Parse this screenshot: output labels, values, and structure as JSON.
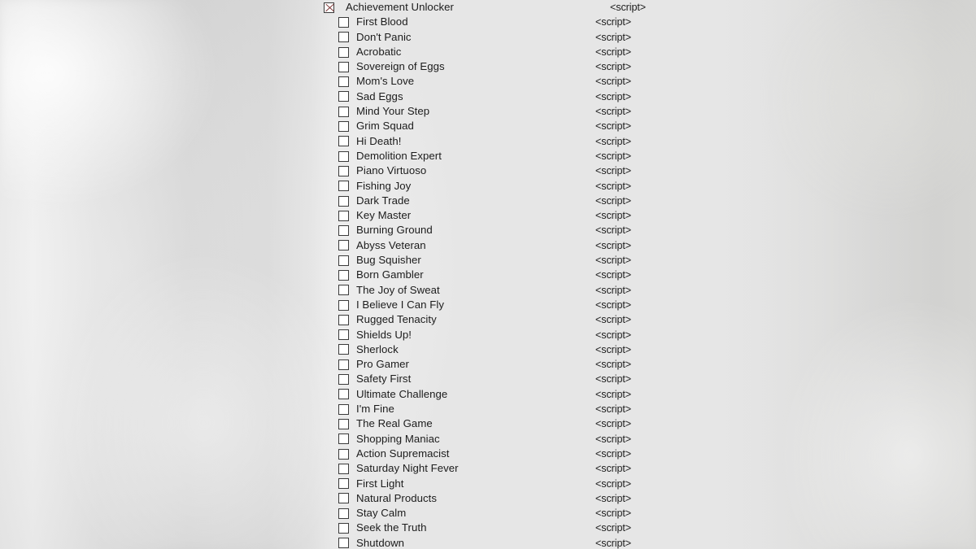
{
  "window": {
    "title": "Achievement Unlocker",
    "background_left_color": "#e6e6e6",
    "background_right_color": "#ececea",
    "panel_color": "#ffffff"
  },
  "tree": {
    "root": {
      "label": "Achievement Unlocker",
      "checkbox_state": "checked",
      "checkbox_mark": "x-mark",
      "checkbox_mark_color": "#7a3030",
      "value": "<script>"
    },
    "value_column_label": "<script>",
    "items": [
      {
        "label": "First Blood",
        "checkbox_state": "unchecked",
        "value": "<script>"
      },
      {
        "label": "Don't Panic",
        "checkbox_state": "unchecked",
        "value": "<script>"
      },
      {
        "label": "Acrobatic",
        "checkbox_state": "unchecked",
        "value": "<script>"
      },
      {
        "label": "Sovereign of Eggs",
        "checkbox_state": "unchecked",
        "value": "<script>"
      },
      {
        "label": "Mom's Love",
        "checkbox_state": "unchecked",
        "value": "<script>"
      },
      {
        "label": "Sad Eggs",
        "checkbox_state": "unchecked",
        "value": "<script>"
      },
      {
        "label": "Mind Your Step",
        "checkbox_state": "unchecked",
        "value": "<script>"
      },
      {
        "label": "Grim Squad",
        "checkbox_state": "unchecked",
        "value": "<script>"
      },
      {
        "label": "Hi Death!",
        "checkbox_state": "unchecked",
        "value": "<script>"
      },
      {
        "label": "Demolition Expert",
        "checkbox_state": "unchecked",
        "value": "<script>"
      },
      {
        "label": "Piano Virtuoso",
        "checkbox_state": "unchecked",
        "value": "<script>"
      },
      {
        "label": "Fishing Joy",
        "checkbox_state": "unchecked",
        "value": "<script>"
      },
      {
        "label": "Dark Trade",
        "checkbox_state": "unchecked",
        "value": "<script>"
      },
      {
        "label": "Key Master",
        "checkbox_state": "unchecked",
        "value": "<script>"
      },
      {
        "label": "Burning Ground",
        "checkbox_state": "unchecked",
        "value": "<script>"
      },
      {
        "label": "Abyss Veteran",
        "checkbox_state": "unchecked",
        "value": "<script>"
      },
      {
        "label": "Bug Squisher",
        "checkbox_state": "unchecked",
        "value": "<script>"
      },
      {
        "label": "Born Gambler",
        "checkbox_state": "unchecked",
        "value": "<script>"
      },
      {
        "label": "The Joy of Sweat",
        "checkbox_state": "unchecked",
        "value": "<script>"
      },
      {
        "label": "I Believe I Can Fly",
        "checkbox_state": "unchecked",
        "value": "<script>"
      },
      {
        "label": "Rugged Tenacity",
        "checkbox_state": "unchecked",
        "value": "<script>"
      },
      {
        "label": "Shields Up!",
        "checkbox_state": "unchecked",
        "value": "<script>"
      },
      {
        "label": "Sherlock",
        "checkbox_state": "unchecked",
        "value": "<script>"
      },
      {
        "label": "Pro Gamer",
        "checkbox_state": "unchecked",
        "value": "<script>"
      },
      {
        "label": "Safety First",
        "checkbox_state": "unchecked",
        "value": "<script>"
      },
      {
        "label": "Ultimate Challenge",
        "checkbox_state": "unchecked",
        "value": "<script>"
      },
      {
        "label": "I'm Fine",
        "checkbox_state": "unchecked",
        "value": "<script>"
      },
      {
        "label": "The Real Game",
        "checkbox_state": "unchecked",
        "value": "<script>"
      },
      {
        "label": "Shopping Maniac",
        "checkbox_state": "unchecked",
        "value": "<script>"
      },
      {
        "label": "Action Supremacist",
        "checkbox_state": "unchecked",
        "value": "<script>"
      },
      {
        "label": "Saturday Night Fever",
        "checkbox_state": "unchecked",
        "value": "<script>"
      },
      {
        "label": "First Light",
        "checkbox_state": "unchecked",
        "value": "<script>"
      },
      {
        "label": "Natural Products",
        "checkbox_state": "unchecked",
        "value": "<script>"
      },
      {
        "label": "Stay Calm",
        "checkbox_state": "unchecked",
        "value": "<script>"
      },
      {
        "label": "Seek the Truth",
        "checkbox_state": "unchecked",
        "value": "<script>"
      },
      {
        "label": "Shutdown",
        "checkbox_state": "unchecked",
        "value": "<script>"
      }
    ]
  }
}
